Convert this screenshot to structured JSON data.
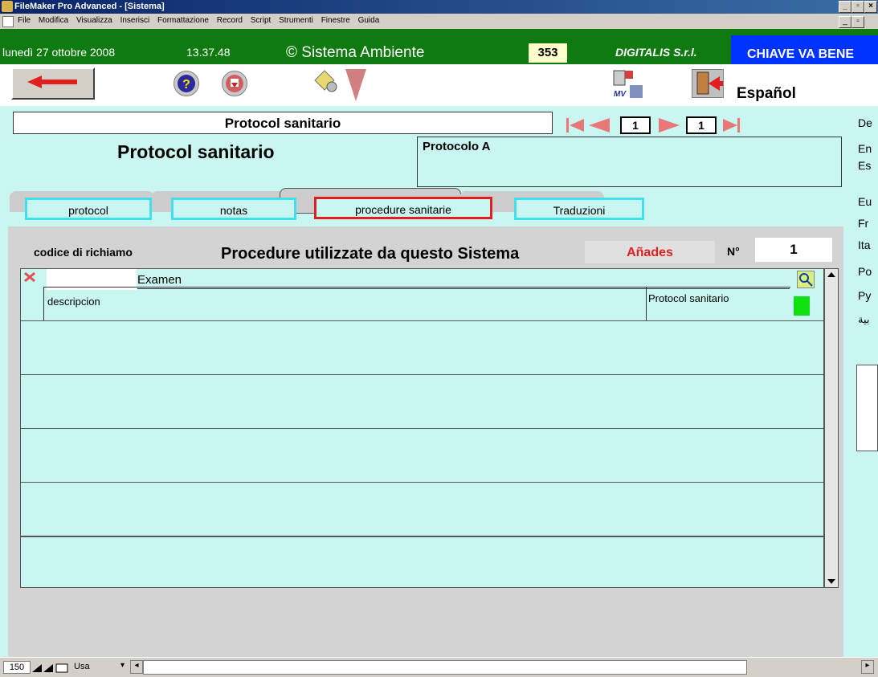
{
  "window": {
    "title": "FileMaker Pro Advanced - [Sistema]"
  },
  "menu": {
    "items": [
      "File",
      "Modifica",
      "Visualizza",
      "Inserisci",
      "Formattazione",
      "Record",
      "Script",
      "Strumenti",
      "Finestre",
      "Guida"
    ]
  },
  "header": {
    "date": "lunedì 27 ottobre 2008",
    "time": "13.37.48",
    "app_name": "© Sistema Ambiente",
    "count": "353",
    "company": "DIGITALIS S.r.l.",
    "banner": "CHIAVE VA BENE"
  },
  "toolbar": {
    "language": "Español"
  },
  "record": {
    "title_field": "Protocol sanitario",
    "heading": "Protocol sanitario",
    "name_value": "Protocolo A",
    "nav_current": "1",
    "nav_total": "1"
  },
  "languages": [
    "De",
    "En",
    "Es",
    "Eu",
    "Fr",
    "Ita",
    "Po",
    "Py",
    "بية"
  ],
  "tabs": [
    {
      "label": "protocol"
    },
    {
      "label": "notas"
    },
    {
      "label": "procedure sanitarie"
    },
    {
      "label": "Traduzioni"
    }
  ],
  "portal": {
    "code_label": "codice di richiamo",
    "heading": "Procedure utilizzate da questo Sistema",
    "add_button": "Añades",
    "number_label": "N°",
    "number_value": "1",
    "row1": {
      "code": "",
      "exam": "Examen",
      "description": "descripcion",
      "protocol": "Protocol sanitario"
    }
  },
  "status": {
    "zoom": "150",
    "mode": "Usa"
  },
  "colors": {
    "green_header": "#0f7a10",
    "banner_blue": "#0033ff",
    "field_cyan": "#c9f6f0",
    "red_accent": "#e02020"
  }
}
